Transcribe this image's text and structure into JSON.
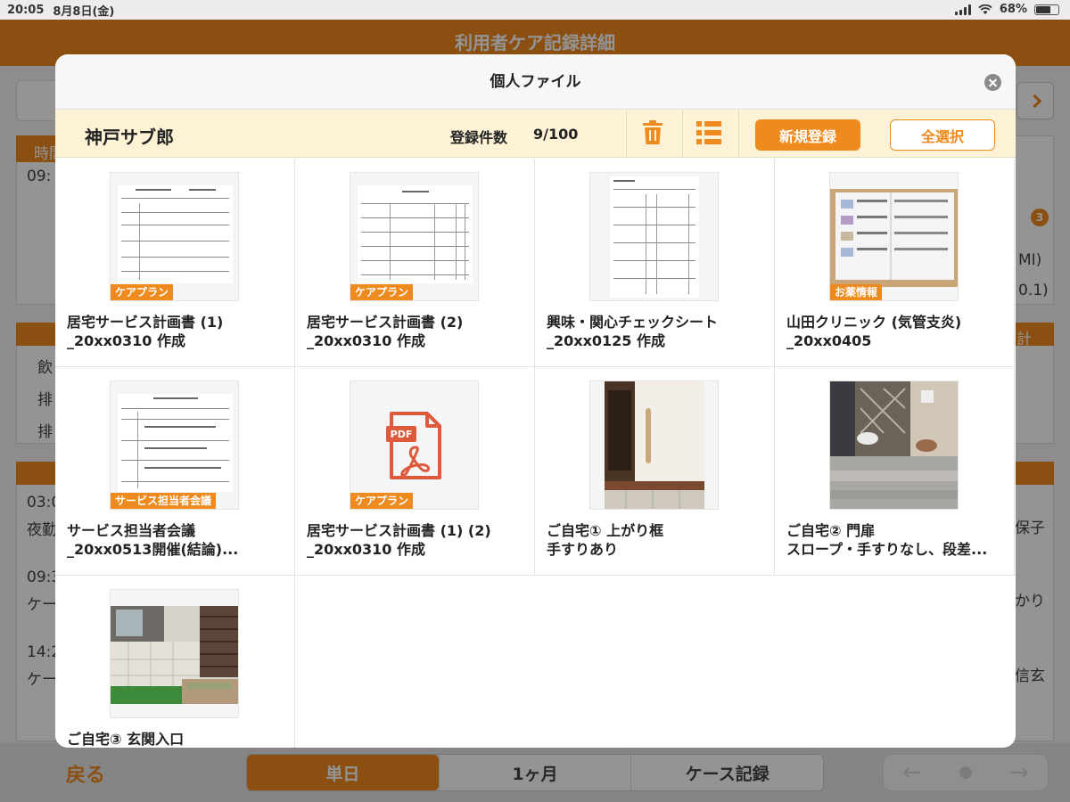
{
  "status_bar": {
    "time": "20:05",
    "date": "8月8日(金)",
    "battery": "68%",
    "battery_level": 0.68
  },
  "app": {
    "title": "利用者ケア記録詳細",
    "background_text": [
      "時間",
      "09:",
      "飲",
      "排",
      "排",
      "03:0",
      "夜勤",
      "09:3",
      "ケー",
      "14:2",
      "ケー",
      "MI)",
      "0.1)",
      "計",
      "保子",
      "かり",
      "信玄"
    ],
    "badge": "3",
    "bottom": {
      "back_label": "戻る",
      "segments": [
        "単日",
        "1ヶ月",
        "ケース記録"
      ],
      "active_segment": 0
    }
  },
  "modal": {
    "title": "個人ファイル",
    "user_name": "神戸サブ郎",
    "count_label": "登録件数",
    "count_value": "9/100",
    "new_label": "新規登録",
    "select_all_label": "全選択",
    "files": [
      {
        "tag": "ケアプラン",
        "line1": "居宅サービス計画書 (1)",
        "line2": "_20xx0310 作成",
        "thumb": "doc"
      },
      {
        "tag": "ケアプラン",
        "line1": "居宅サービス計画書 (2)",
        "line2": "_20xx0310 作成",
        "thumb": "doc"
      },
      {
        "tag": "",
        "line1": "興味・関心チェックシート",
        "line2": "_20xx0125 作成",
        "thumb": "doc"
      },
      {
        "tag": "お薬情報",
        "line1": "山田クリニック (気管支炎)",
        "line2": "_20xx0405",
        "thumb": "photo"
      },
      {
        "tag": "サービス担当者会議",
        "line1": "サービス担当者会議",
        "line2": "_20xx0513開催(結論)...",
        "thumb": "doc"
      },
      {
        "tag": "ケアプラン",
        "line1": "居宅サービス計画書 (1) (2)",
        "line2": "_20xx0310 作成",
        "thumb": "pdf"
      },
      {
        "tag": "",
        "line1": "ご自宅① 上がり框",
        "line2": "手すりあり",
        "thumb": "photo"
      },
      {
        "tag": "",
        "line1": "ご自宅② 門扉",
        "line2": "スロープ・手すりなし、段差...",
        "thumb": "photo"
      },
      {
        "tag": "",
        "line1": "ご自宅③ 玄関入口",
        "line2": "",
        "thumb": "photo"
      }
    ],
    "pdf_icon_label": "PDF"
  },
  "colors": {
    "accent": "#ef8a1e",
    "toolbar_bg": "#fdf1d6"
  }
}
